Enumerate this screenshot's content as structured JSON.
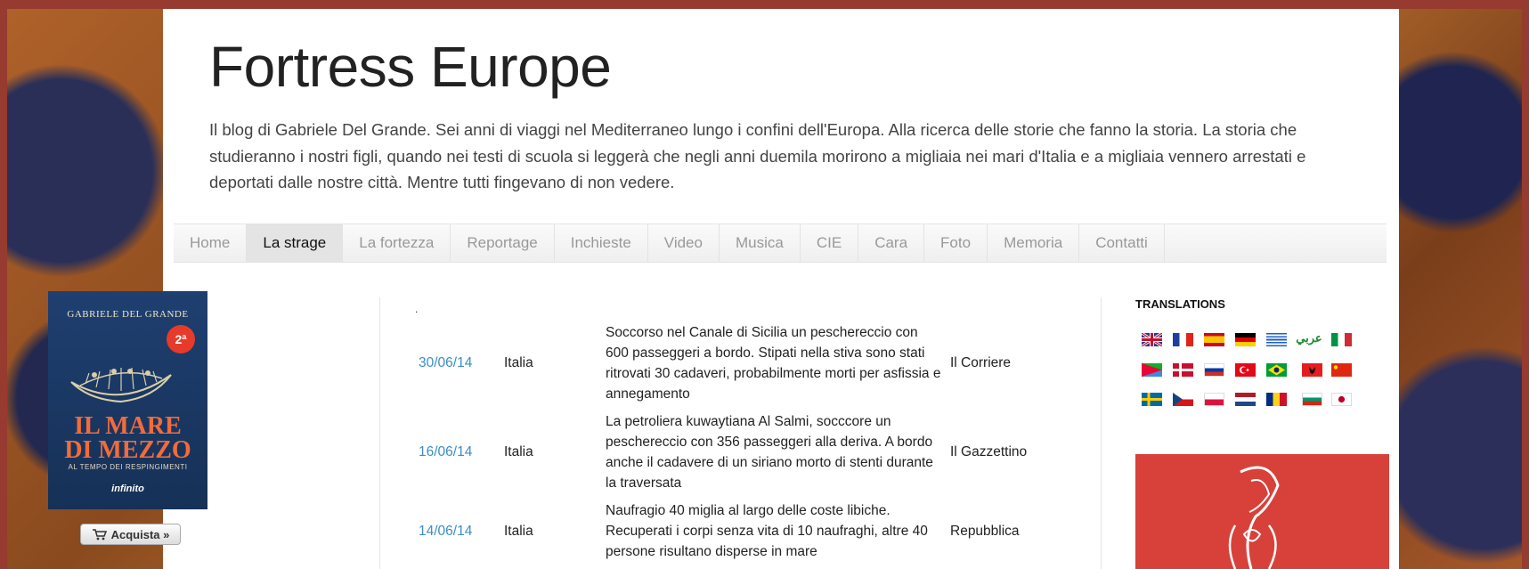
{
  "site": {
    "title": "Fortress Europe",
    "description": "Il blog di Gabriele Del Grande. Sei anni di viaggi nel Mediterraneo lungo i confini dell'Europa. Alla ricerca delle storie che fanno la storia. La storia che studieranno i nostri figli, quando nei testi di scuola si leggerà che negli anni duemila morirono a migliaia nei mari d'Italia e a migliaia vennero arrestati e deportati dalle nostre città. Mentre tutti fingevano di non vedere."
  },
  "nav": {
    "tabs": [
      {
        "label": "Home"
      },
      {
        "label": "La strage"
      },
      {
        "label": "La fortezza"
      },
      {
        "label": "Reportage"
      },
      {
        "label": "Inchieste"
      },
      {
        "label": "Video"
      },
      {
        "label": "Musica"
      },
      {
        "label": "CIE"
      },
      {
        "label": "Cara"
      },
      {
        "label": "Foto"
      },
      {
        "label": "Memoria"
      },
      {
        "label": "Contatti"
      }
    ],
    "active": "La strage"
  },
  "book": {
    "author": "GABRIELE DEL GRANDE",
    "edition": "2ª",
    "title_line1": "IL MARE",
    "title_line2": "DI MEZZO",
    "subtitle": "AL TEMPO DEI RESPINGIMENTI",
    "publisher": "infinito",
    "buy_label": "Acquista »"
  },
  "list": {
    "marker": ".",
    "rows": [
      {
        "date": "30/06/14",
        "place": "Italia",
        "text": "Soccorso nel Canale di Sicilia un peschereccio con 600 passeggeri a bordo. Stipati nella stiva sono stati ritrovati 30 cadaveri, probabilmente morti per asfissia e annegamento",
        "source": "Il Corriere"
      },
      {
        "date": "16/06/14",
        "place": "Italia",
        "text": "La petroliera kuwaytiana Al Salmi, socccore un peschereccio con 356 passeggeri alla deriva. A bordo anche il cadavere di un siriano morto di stenti durante la traversata",
        "source": "Il Gazzettino"
      },
      {
        "date": "14/06/14",
        "place": "Italia",
        "text": "Naufragio 40 miglia al largo delle coste libiche. Recuperati i corpi senza vita di 10 naufraghi, altre 40 persone risultano disperse in mare",
        "source": "Repubblica"
      }
    ]
  },
  "translations": {
    "heading": "TRANSLATIONS",
    "arabic_label": "عربي",
    "flags": [
      "uk-flag-icon",
      "france-flag-icon",
      "spain-flag-icon",
      "germany-flag-icon",
      "greece-flag-icon",
      "arabic-language-icon",
      "italy-flag-icon",
      "eritrea-flag-icon",
      "denmark-flag-icon",
      "russia-flag-icon",
      "turkey-flag-icon",
      "brazil-flag-icon",
      "albania-flag-icon",
      "china-flag-icon",
      "sweden-flag-icon",
      "czech-flag-icon",
      "poland-flag-icon",
      "netherlands-flag-icon",
      "romania-flag-icon",
      "bulgaria-flag-icon",
      "japan-flag-icon"
    ]
  },
  "colors": {
    "frame": "#973a2f",
    "link": "#3a8fc4",
    "poster": "#d7413a"
  }
}
